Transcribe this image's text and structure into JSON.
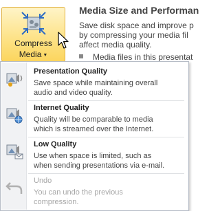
{
  "compress_button": {
    "label_line1": "Compress",
    "label_line2": "Media",
    "icon": "compress-media-icon",
    "dropdown_icon": "caret-down-icon"
  },
  "info_panel": {
    "title": "Media Size and Performan",
    "body_lines": [
      "Save disk space and improve p",
      "by compressing your media fil",
      "affect media quality."
    ],
    "bullet": "Media files in this presentat"
  },
  "menu": {
    "items": [
      {
        "title": "Presentation Quality",
        "desc_lines": [
          "Save space while maintaining overall",
          "audio and video quality."
        ],
        "icon": "presentation-quality-icon",
        "enabled": true
      },
      {
        "title": "Internet Quality",
        "desc_lines": [
          "Quality will be comparable to media",
          "which is streamed over the Internet."
        ],
        "icon": "internet-quality-icon",
        "enabled": true
      },
      {
        "title": "Low Quality",
        "desc_lines": [
          "Use when space is limited, such as",
          "when sending presentations via e-mail."
        ],
        "icon": "low-quality-icon",
        "enabled": true
      },
      {
        "title": "Undo",
        "desc_lines": [
          "You can undo the previous",
          "compression."
        ],
        "icon": "undo-icon",
        "enabled": false
      }
    ]
  },
  "colors": {
    "button_highlight": "#fde38a",
    "button_border": "#e0b040",
    "menu_border": "#b6bcc6",
    "gutter": "#f1f2f4",
    "disabled_text": "#a7a7a7"
  }
}
